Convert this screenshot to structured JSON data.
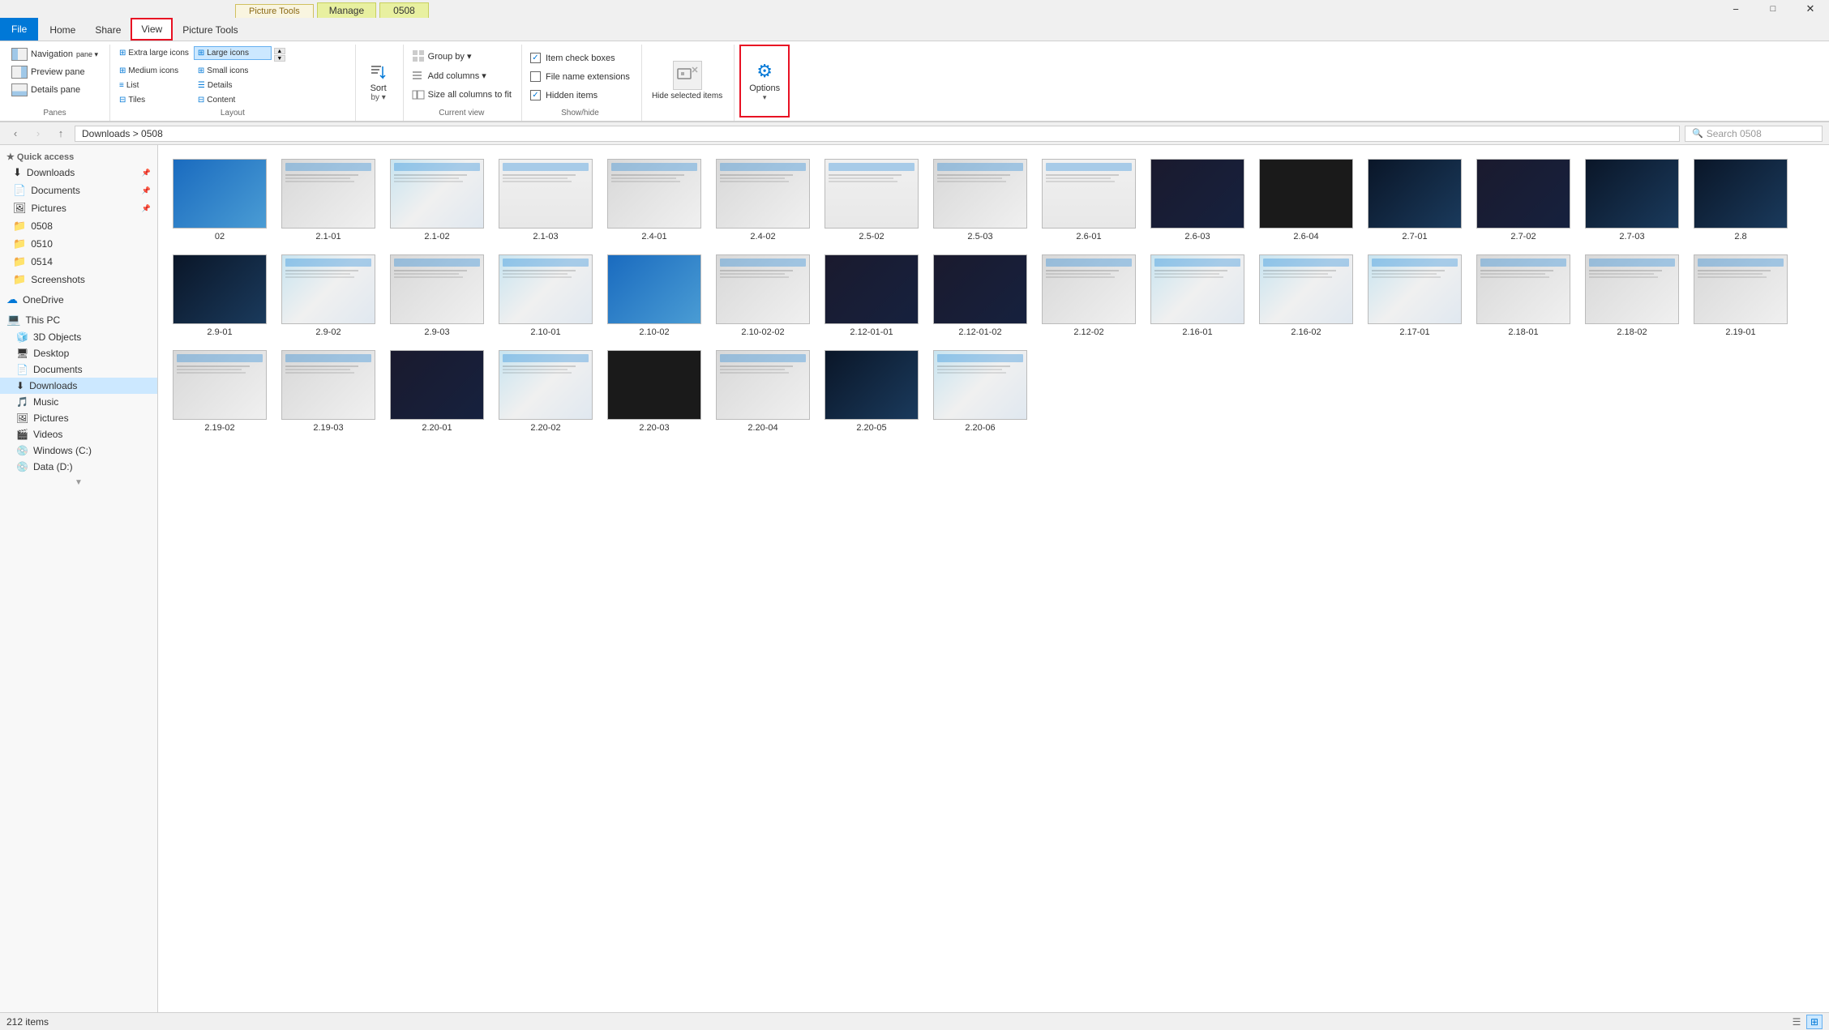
{
  "window": {
    "title": "0508",
    "min": "−",
    "max": "□",
    "close": "✕"
  },
  "tabs": {
    "file": "File",
    "home": "Home",
    "share": "Share",
    "view": "View",
    "picture_tools": "Picture Tools",
    "manage": "Manage"
  },
  "ribbon": {
    "panes": {
      "label": "Panes",
      "nav_pane": "Navigation",
      "nav_pane_sub": "pane ▾",
      "preview": "Preview pane",
      "details": "Details pane"
    },
    "layout": {
      "label": "Layout",
      "extra_large": "Extra large icons",
      "large": "Large icons",
      "medium": "Medium icons",
      "small": "Small icons",
      "list": "List",
      "details": "Details",
      "tiles": "Tiles",
      "content": "Content"
    },
    "sort": {
      "label": "",
      "btn": "Sort",
      "sub": "by ▾"
    },
    "current_view": {
      "label": "Current view",
      "group_by": "Group by ▾",
      "add_columns": "Add columns ▾",
      "size_all": "Size all columns to fit"
    },
    "show_hide": {
      "label": "Show/hide",
      "item_check": "Item check boxes",
      "file_ext": "File name extensions",
      "hidden": "Hidden items",
      "item_check_checked": true,
      "file_ext_checked": false,
      "hidden_checked": true
    },
    "hide_selected": {
      "label": "Hide selected\nitems"
    },
    "options": {
      "label": "Options"
    }
  },
  "sidebar": {
    "quick_access": [
      {
        "name": "Downloads",
        "icon": "⬇",
        "pinned": true,
        "active": false
      },
      {
        "name": "Documents",
        "icon": "📄",
        "pinned": true
      },
      {
        "name": "Pictures",
        "icon": "🖼",
        "pinned": true
      },
      {
        "name": "0508",
        "icon": "📁",
        "pinned": false
      },
      {
        "name": "0510",
        "icon": "📁",
        "pinned": false
      },
      {
        "name": "0514",
        "icon": "📁",
        "pinned": false
      },
      {
        "name": "Screenshots",
        "icon": "📁",
        "pinned": false
      }
    ],
    "onedrive": {
      "name": "OneDrive",
      "icon": "☁"
    },
    "this_pc": {
      "label": "This PC",
      "items": [
        {
          "name": "3D Objects",
          "icon": "🧊"
        },
        {
          "name": "Desktop",
          "icon": "🖥"
        },
        {
          "name": "Documents",
          "icon": "📄"
        },
        {
          "name": "Downloads",
          "icon": "⬇"
        },
        {
          "name": "Music",
          "icon": "🎵"
        },
        {
          "name": "Pictures",
          "icon": "🖼"
        },
        {
          "name": "Videos",
          "icon": "🎬"
        },
        {
          "name": "Windows (C:)",
          "icon": "💿"
        },
        {
          "name": "Data (D:)",
          "icon": "💿"
        }
      ]
    }
  },
  "files": [
    {
      "name": "02",
      "thumb_class": "thumb-blue"
    },
    {
      "name": "2.1-01",
      "thumb_class": "thumb-gray"
    },
    {
      "name": "2.1-02",
      "thumb_class": "thumb-mixed"
    },
    {
      "name": "2.1-03",
      "thumb_class": "thumb-win"
    },
    {
      "name": "2.4-01",
      "thumb_class": "thumb-gray"
    },
    {
      "name": "2.4-02",
      "thumb_class": "thumb-gray"
    },
    {
      "name": "2.5-02",
      "thumb_class": "thumb-win"
    },
    {
      "name": "2.5-03",
      "thumb_class": "thumb-gray"
    },
    {
      "name": "2.6-01",
      "thumb_class": "thumb-win"
    },
    {
      "name": "2.6-03",
      "thumb_class": "thumb-dark"
    },
    {
      "name": "2.6-04",
      "thumb_class": "thumb-black"
    },
    {
      "name": "2.7-01",
      "thumb_class": "thumb-dark-blue"
    },
    {
      "name": "2.7-02",
      "thumb_class": "thumb-dark"
    },
    {
      "name": "2.7-03",
      "thumb_class": "thumb-dark-blue"
    },
    {
      "name": "2.8",
      "thumb_class": "thumb-dark-blue"
    },
    {
      "name": "2.9-01",
      "thumb_class": "thumb-dark-blue"
    },
    {
      "name": "2.9-02",
      "thumb_class": "thumb-mixed"
    },
    {
      "name": "2.9-03",
      "thumb_class": "thumb-gray"
    },
    {
      "name": "2.10-01",
      "thumb_class": "thumb-mixed"
    },
    {
      "name": "2.10-02",
      "thumb_class": "thumb-blue"
    },
    {
      "name": "2.10-02-02",
      "thumb_class": "thumb-gray"
    },
    {
      "name": "2.12-01-01",
      "thumb_class": "thumb-dark"
    },
    {
      "name": "2.12-01-02",
      "thumb_class": "thumb-dark"
    },
    {
      "name": "2.12-02",
      "thumb_class": "thumb-gray"
    },
    {
      "name": "2.16-01",
      "thumb_class": "thumb-mixed"
    },
    {
      "name": "2.16-02",
      "thumb_class": "thumb-mixed"
    },
    {
      "name": "2.17-01",
      "thumb_class": "thumb-mixed"
    },
    {
      "name": "2.18-01",
      "thumb_class": "thumb-gray"
    },
    {
      "name": "2.18-02",
      "thumb_class": "thumb-gray"
    },
    {
      "name": "2.19-01",
      "thumb_class": "thumb-gray"
    },
    {
      "name": "2.19-02",
      "thumb_class": "thumb-gray"
    },
    {
      "name": "2.19-03",
      "thumb_class": "thumb-gray"
    },
    {
      "name": "2.20-01",
      "thumb_class": "thumb-dark"
    },
    {
      "name": "2.20-02",
      "thumb_class": "thumb-mixed"
    },
    {
      "name": "2.20-03",
      "thumb_class": "thumb-black"
    },
    {
      "name": "2.20-04",
      "thumb_class": "thumb-gray"
    },
    {
      "name": "2.20-05",
      "thumb_class": "thumb-dark-blue"
    },
    {
      "name": "2.20-06",
      "thumb_class": "thumb-mixed"
    }
  ],
  "status": {
    "count": "212 items"
  },
  "address": {
    "path": "Downloads > 0508",
    "search": "Search 0508"
  }
}
